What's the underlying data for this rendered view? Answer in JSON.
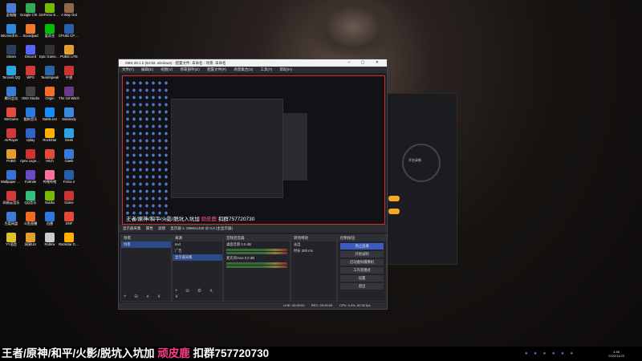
{
  "desktop": {
    "icons": [
      {
        "label": "此电脑",
        "color": "#4d7bd1"
      },
      {
        "label": "Microsoft Edge",
        "color": "#2b8ad9"
      },
      {
        "label": "Steam",
        "color": "#2a3f5a"
      },
      {
        "label": "Tencent QQ",
        "color": "#2aa5e0"
      },
      {
        "label": "腾讯会议",
        "color": "#3a7bd5"
      },
      {
        "label": "WeGame",
        "color": "#e24b3a"
      },
      {
        "label": "AirPlayer",
        "color": "#d03a3a"
      },
      {
        "label": "PUBG",
        "color": "#e0a030"
      },
      {
        "label": "Wallpaper Engine",
        "color": "#3b6fd1"
      },
      {
        "label": "网易云音乐",
        "color": "#d33a3a"
      },
      {
        "label": "百度网盘",
        "color": "#3a7bd5"
      },
      {
        "label": "YY语音",
        "color": "#e0c030"
      },
      {
        "label": "Google Chrome",
        "color": "#34a853"
      },
      {
        "label": "Soundpad",
        "color": "#ef7b2a"
      },
      {
        "label": "Discord",
        "color": "#5865f2"
      },
      {
        "label": "WPS",
        "color": "#d33a3a"
      },
      {
        "label": "OBS Studio",
        "color": "#444"
      },
      {
        "label": "酷狗音乐",
        "color": "#2a7be0"
      },
      {
        "label": "Uplay",
        "color": "#2f64c6"
      },
      {
        "label": "Apex Legends",
        "color": "#c33"
      },
      {
        "label": "Fortnite",
        "color": "#6a4cc0"
      },
      {
        "label": "QQ音乐",
        "color": "#31c27c"
      },
      {
        "label": "斗鱼直播",
        "color": "#f26a21"
      },
      {
        "label": "网易UU",
        "color": "#e0a030"
      },
      {
        "label": "GeForce Experience",
        "color": "#76b900"
      },
      {
        "label": "爱奇艺",
        "color": "#00be06"
      },
      {
        "label": "Epic Games Launcher",
        "color": "#333"
      },
      {
        "label": "TeamSpeak",
        "color": "#2b65a8"
      },
      {
        "label": "Origin",
        "color": "#f56c2d"
      },
      {
        "label": "Battle.net",
        "color": "#148eff"
      },
      {
        "label": "RockStar",
        "color": "#ffb000"
      },
      {
        "label": "Hitch",
        "color": "#e24b3a"
      },
      {
        "label": "哔哩哔哩",
        "color": "#fb7299"
      },
      {
        "label": "Nvidia",
        "color": "#76b900"
      },
      {
        "label": "迅雷",
        "color": "#2a7be0"
      },
      {
        "label": "Roblox",
        "color": "#ccc"
      },
      {
        "label": "A Way Out",
        "color": "#8a6a4a"
      },
      {
        "label": "CPUID CPU-Z",
        "color": "#2a5fa8"
      },
      {
        "label": "PUBG LITE",
        "color": "#e0a030"
      },
      {
        "label": "中望",
        "color": "#c33"
      },
      {
        "label": "The 1st Witch",
        "color": "#6a3a8a"
      },
      {
        "label": "Sidebody",
        "color": "#3a8ad9"
      },
      {
        "label": "Geek",
        "color": "#2aa5e0"
      },
      {
        "label": "Clash",
        "color": "#3a7bd5"
      },
      {
        "label": "Forza 4",
        "color": "#2a5fa8"
      },
      {
        "label": "Game",
        "color": "#c33"
      },
      {
        "label": "DNF",
        "color": "#e24b3a"
      },
      {
        "label": "Rockstar Games",
        "color": "#ffb000"
      }
    ]
  },
  "side_panel": {
    "ring_label": "开启录制"
  },
  "obs": {
    "title": "OBS 28.1.2 (64-bit, windows) - 配置文件: 未命名 - 场景: 未命名",
    "menu": [
      "文件(F)",
      "编辑(E)",
      "视图(V)",
      "停靠部件(D)",
      "配置文件(P)",
      "场景集合(S)",
      "工具(T)",
      "帮助(H)"
    ],
    "preview_caption": {
      "prefix": "王者/原神/和平/火影/脱坑入坑加 ",
      "highlight": "顽皮鹿",
      "suffix": " 扣群757720730"
    },
    "source_toolbar": [
      "显示器采集",
      "属性",
      "滤镜",
      "显示器 1: 2560x1440 @ 0,0 (主显示器)"
    ],
    "scenes": {
      "title": "场景",
      "items": [
        "场景"
      ]
    },
    "sources": {
      "title": "来源",
      "items": [
        "text",
        "广告",
        "显示器采集"
      ]
    },
    "mixer": {
      "title": "音频混音器",
      "channels": [
        {
          "name": "桌面音频",
          "db": "0.0 dB"
        },
        {
          "name": "麦克风/Aux",
          "db": "0.0 dB"
        }
      ]
    },
    "transitions": {
      "title": "转场特效",
      "type": "淡出",
      "duration_label": "时长",
      "duration": "300 ms"
    },
    "controls": {
      "title": "控制按钮",
      "buttons": [
        "停止直播",
        "开始录制",
        "启动虚拟摄像机",
        "工作室模式",
        "设置",
        "退出"
      ]
    },
    "status": {
      "live": "LIVE: 00:00:00",
      "rec": "REC: 00:00:00",
      "cpu": "CPU: 0.4%, 60.00 fps"
    }
  },
  "banner": {
    "prefix": "王者/原神/和平/火影/脱坑入坑加 ",
    "highlight": "顽皮鹿",
    "suffix": " 扣群757720730"
  },
  "tray": {
    "time": "4:56",
    "date": "2022/11/23"
  }
}
